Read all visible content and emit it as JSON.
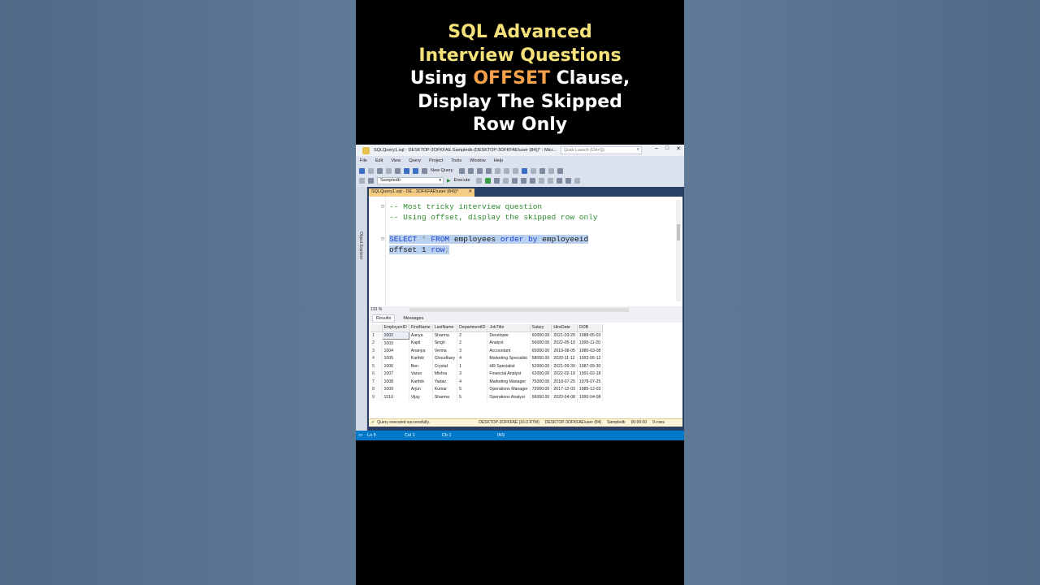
{
  "title": {
    "line1": "SQL Advanced",
    "line2": "Interview Questions",
    "line3_pre": "Using ",
    "line3_highlight": "OFFSET",
    "line3_post": " Clause,",
    "line4": "Display The Skipped",
    "line5": "Row Only"
  },
  "window": {
    "title": "SQLQuery1.sql - DESKTOP-3OFKFAE.Sampledb (DESKTOP-3OFKFAE\\user (84))* - Micr...",
    "quick_launch_placeholder": "Quick Launch (Ctrl+Q)"
  },
  "menu": [
    "File",
    "Edit",
    "View",
    "Query",
    "Project",
    "Tools",
    "Window",
    "Help"
  ],
  "toolbar": {
    "new_query": "New Query",
    "database": "Sampledb",
    "execute": "Execute"
  },
  "sidebar": {
    "label": "Object Explorer"
  },
  "tab": {
    "label": "SQLQuery1.sql - DE...3OFKFAE\\user (84))*",
    "close": "✕"
  },
  "editor": {
    "comment1": "-- Most tricky interview question",
    "comment2": "-- Using offset, display the skipped row only",
    "select_kw": "SELECT",
    "star": " * ",
    "from_kw": "FROM",
    "table": " employees ",
    "order_kw": "order by",
    "col": " employeeid",
    "offset": "offset 1 ",
    "row_kw": "row",
    "semicolon": ";"
  },
  "zoom": "133 %",
  "results": {
    "tabs": [
      "Results",
      "Messages"
    ],
    "columns": [
      "EmployeeID",
      "FirstName",
      "LastName",
      "DepartmentID",
      "JobTitle",
      "Salary",
      "HireDate",
      "DOB"
    ],
    "rows": [
      [
        "1",
        "1002",
        "Aanya",
        "Sharma",
        "2",
        "Developer",
        "60000.00",
        "2021-03-20",
        "1988-05-03"
      ],
      [
        "2",
        "1003",
        "Kapil",
        "Singh",
        "2",
        "Analyst",
        "56000.00",
        "2022-05-10",
        "1995-11-20"
      ],
      [
        "3",
        "1004",
        "Ananya",
        "Verma",
        "3",
        "Accountant",
        "65000.00",
        "2019-08-05",
        "1980-03-08"
      ],
      [
        "4",
        "1005",
        "Karthik",
        "Choudhary",
        "4",
        "Marketing Specialist",
        "58000.00",
        "2020-11-12",
        "1992-06-12"
      ],
      [
        "5",
        "1006",
        "Ben",
        "Crystal",
        "1",
        "HR Specialist",
        "52000.00",
        "2021-09-30",
        "1987-09-30"
      ],
      [
        "6",
        "1007",
        "Varun",
        "Mishra",
        "3",
        "Financial Analyst",
        "62000.00",
        "2022-02-18",
        "1991-02-18"
      ],
      [
        "7",
        "1008",
        "Karthik",
        "Yadav",
        "4",
        "Marketing Manager",
        "75000.00",
        "2018-07-25",
        "1978-07-25"
      ],
      [
        "8",
        "1009",
        "Arjun",
        "Kumar",
        "5",
        "Operations Manager",
        "72000.00",
        "2017-12-03",
        "1985-12-03"
      ],
      [
        "9",
        "1010",
        "Vijay",
        "Sharma",
        "5",
        "Operations Analyst",
        "56000.00",
        "2020-04-08",
        "1990-04-08"
      ]
    ]
  },
  "status": {
    "message": "Query executed successfully.",
    "server": "DESKTOP-3OFKFAE (16.0 RTM)",
    "user": "DESKTOP-3OFKFAE\\user (84)",
    "db": "Sampledb",
    "time": "00:00:00",
    "rows": "9 rows"
  },
  "bottom_status": {
    "ln": "Ln 5",
    "col": "Col 1",
    "ch": "Ch 1",
    "ins": "INS"
  },
  "colors": {
    "accent_yellow": "#f5e27a",
    "accent_orange": "#f7a24a",
    "status_blue": "#0079cb"
  }
}
